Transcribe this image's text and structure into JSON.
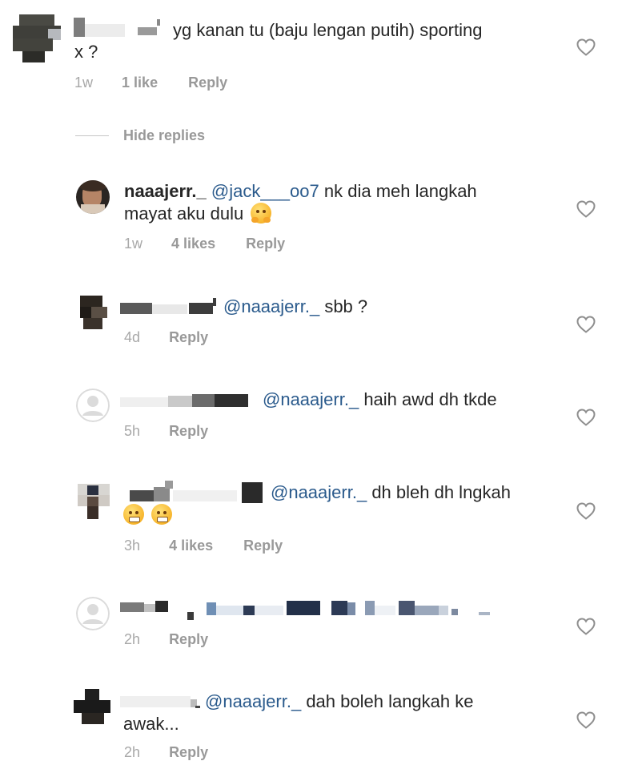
{
  "comments": [
    {
      "id": "c1",
      "username": "",
      "mention": "",
      "text": "yg kanan tu (baju lengan putih) sporting",
      "text_cont": "x ?",
      "time": "1w",
      "likes": "1 like",
      "reply": "Reply"
    },
    {
      "id": "c2",
      "username": "naaajerr._",
      "mention": "@jack___oo7",
      "text": "nk dia meh langkah",
      "text_cont": "mayat aku dulu",
      "emoji": "hugging-face-emoji",
      "time": "1w",
      "likes": "4 likes",
      "reply": "Reply"
    },
    {
      "id": "c3",
      "username": "",
      "mention": "@naaajerr._",
      "text": "sbb ?",
      "time": "4d",
      "reply": "Reply"
    },
    {
      "id": "c4",
      "username": "",
      "mention": "@naaajerr._",
      "text": "haih awd dh tkde",
      "time": "5h",
      "reply": "Reply"
    },
    {
      "id": "c5",
      "username": "",
      "mention": "@naaajerr._",
      "text": "dh bleh dh lngkah",
      "emoji": "grimacing-emoji",
      "time": "3h",
      "likes": "4 likes",
      "reply": "Reply"
    },
    {
      "id": "c6",
      "username": "",
      "time": "2h",
      "reply": "Reply"
    },
    {
      "id": "c7",
      "username": "",
      "mention": "@naaajerr._",
      "text": "dah  boleh langkah ke",
      "text_cont": "awak...",
      "time": "2h",
      "reply": "Reply"
    }
  ],
  "hide_replies": "Hide replies",
  "colors": {
    "text": "#262626",
    "mention": "#2a5a8c",
    "meta": "#999999",
    "heart": "#8e8e8e"
  },
  "icons": {
    "like": "heart-outline-icon",
    "default_avatar": "default-avatar-icon"
  }
}
